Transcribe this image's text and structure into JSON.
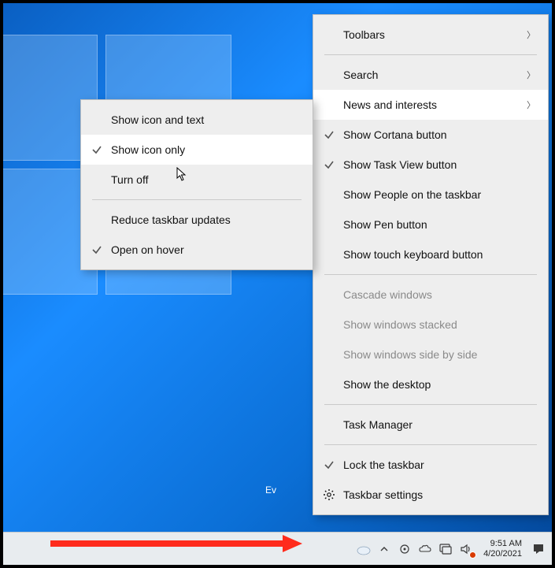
{
  "main_menu": {
    "items": [
      {
        "label": "Toolbars",
        "arrow": true,
        "checked": false
      },
      {
        "label": "Search",
        "arrow": true,
        "checked": false
      },
      {
        "label": "News and interests",
        "arrow": true,
        "checked": false,
        "hovered": true
      },
      {
        "label": "Show Cortana button",
        "checked": true
      },
      {
        "label": "Show Task View button",
        "checked": true
      },
      {
        "label": "Show People on the taskbar",
        "checked": false
      },
      {
        "label": "Show Pen button",
        "checked": false
      },
      {
        "label": "Show touch keyboard button",
        "checked": false
      },
      {
        "label": "Cascade windows",
        "disabled": true
      },
      {
        "label": "Show windows stacked",
        "disabled": true
      },
      {
        "label": "Show windows side by side",
        "disabled": true
      },
      {
        "label": "Show the desktop"
      },
      {
        "label": "Task Manager"
      },
      {
        "label": "Lock the taskbar",
        "checked": true
      },
      {
        "label": "Taskbar settings",
        "icon": "gear"
      }
    ]
  },
  "sub_menu": {
    "items": [
      {
        "label": "Show icon and text"
      },
      {
        "label": "Show icon only",
        "checked": true,
        "hovered": true
      },
      {
        "label": "Turn off"
      },
      {
        "label": "Reduce taskbar updates"
      },
      {
        "label": "Open on hover",
        "checked": true
      }
    ]
  },
  "taskbar": {
    "time": "9:51 AM",
    "date": "4/20/2021"
  },
  "desktop": {
    "text_fragment": "Ev"
  },
  "colors": {
    "menu_bg": "#eeeeee",
    "menu_hover": "#ffffff",
    "taskbar_bg": "#e8ecef",
    "desktop_blue": "#0b6fd6",
    "arrow_red": "#ff2b1c"
  }
}
